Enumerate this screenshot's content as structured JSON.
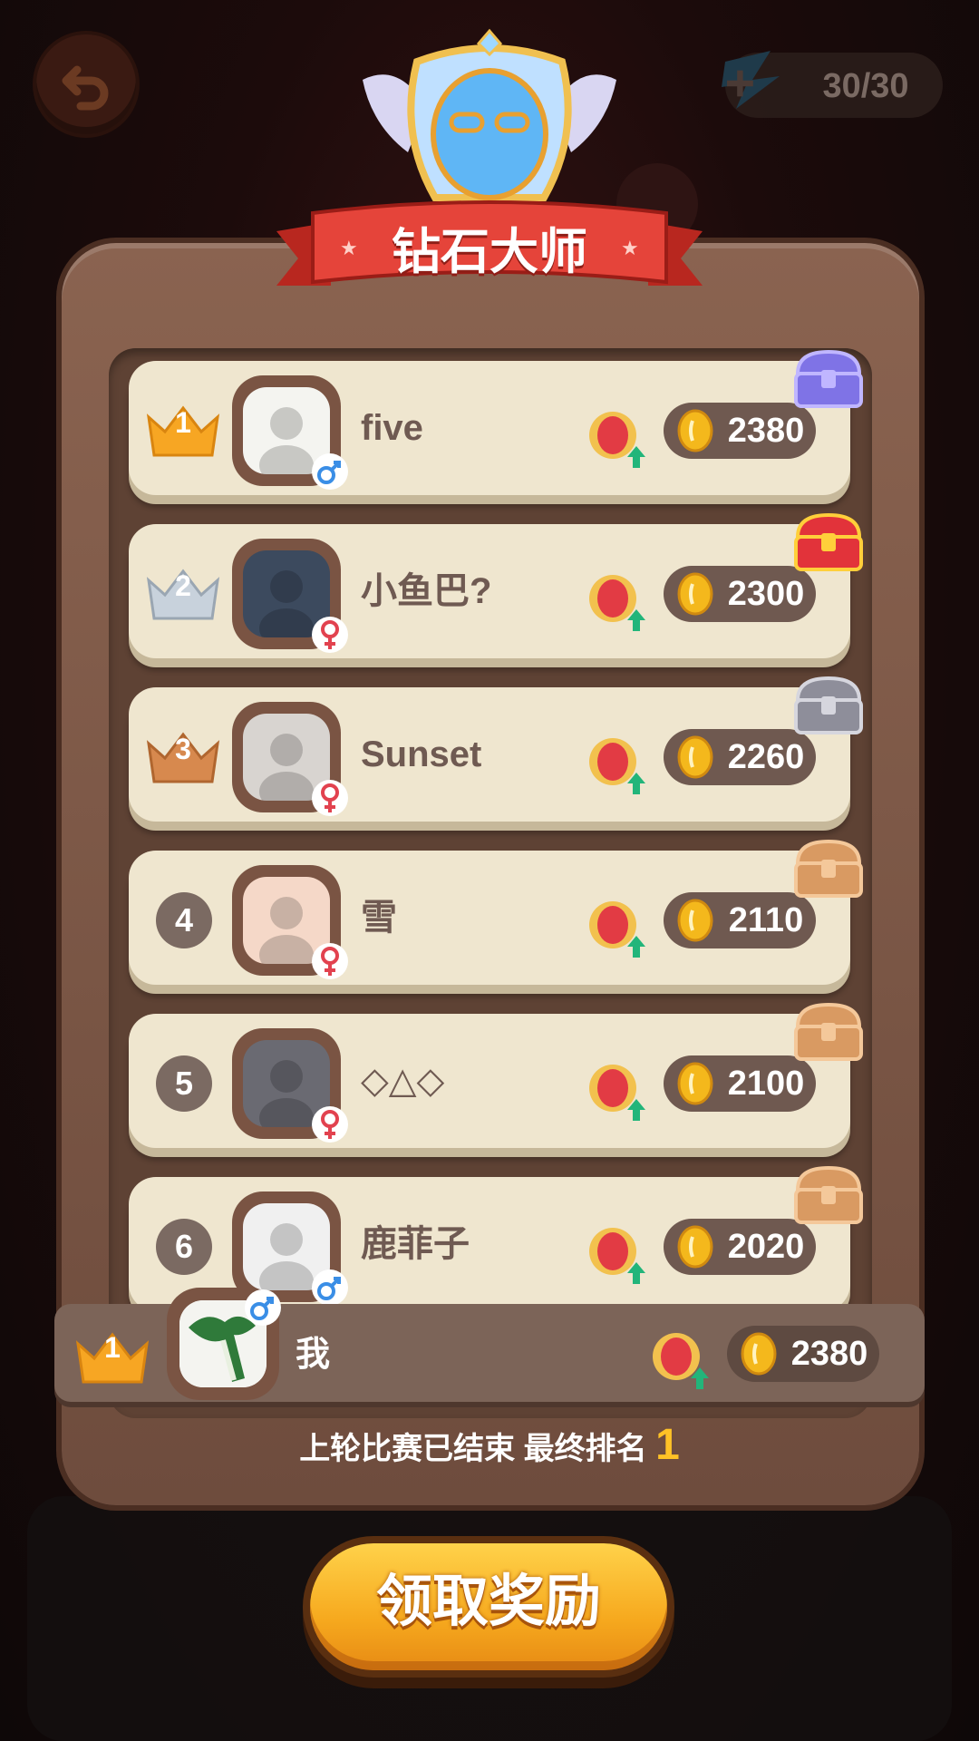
{
  "energy": {
    "text": "30/30"
  },
  "league": {
    "title": "钻石大师"
  },
  "colors": {
    "panel": "#6e4c3d",
    "row": "#efe6cf",
    "gold": "#ffc226",
    "claim": "#f6a91e"
  },
  "rows": [
    {
      "rank": "1",
      "rank_style": "gold-crown",
      "name": "five",
      "gender": "male",
      "score": "2380",
      "chest": "purple-chest"
    },
    {
      "rank": "2",
      "rank_style": "silver-crown",
      "name": "小鱼巴?",
      "gender": "female",
      "score": "2300",
      "chest": "red-chest"
    },
    {
      "rank": "3",
      "rank_style": "bronze-crown",
      "name": "Sunset",
      "gender": "female",
      "score": "2260",
      "chest": "silver-chest"
    },
    {
      "rank": "4",
      "rank_style": "circle",
      "name": "雪",
      "gender": "female",
      "score": "2110",
      "chest": "wood-chest"
    },
    {
      "rank": "5",
      "rank_style": "circle",
      "name": "◇△◇",
      "gender": "female",
      "score": "2100",
      "chest": "wood-chest"
    },
    {
      "rank": "6",
      "rank_style": "circle",
      "name": "鹿菲子",
      "gender": "male",
      "score": "2020",
      "chest": "wood-chest"
    }
  ],
  "me": {
    "rank": "1",
    "name": "我",
    "gender": "male",
    "score": "2380"
  },
  "result": {
    "text": "上轮比赛已结束  最终排名",
    "rank": "1"
  },
  "claim_button": {
    "label": "领取奖励"
  }
}
